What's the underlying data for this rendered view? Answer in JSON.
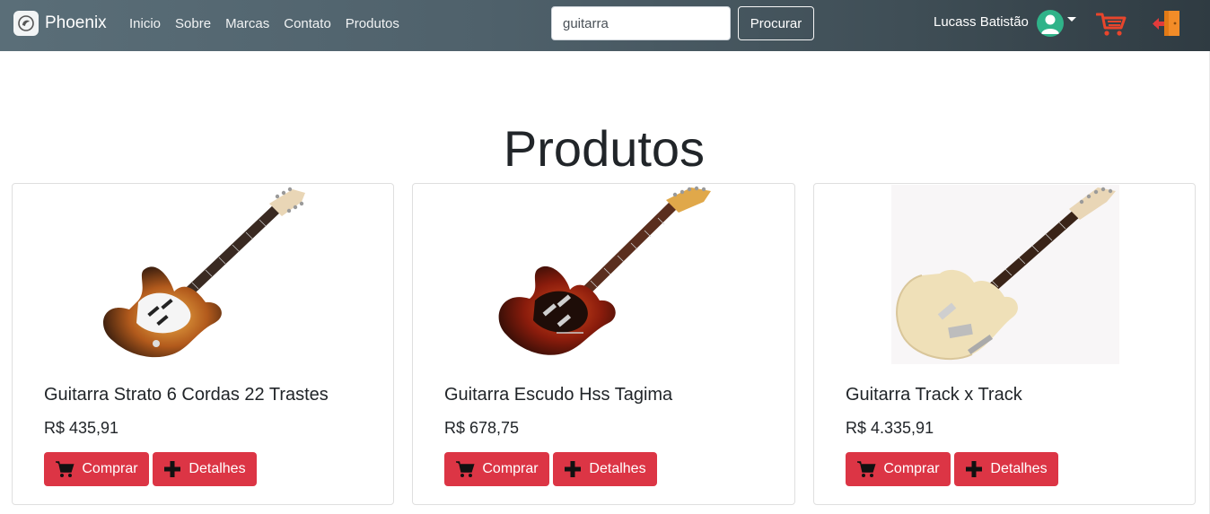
{
  "navbar": {
    "brand": "Phoenix",
    "links": [
      "Inicio",
      "Sobre",
      "Marcas",
      "Contato",
      "Produtos"
    ],
    "search": {
      "value": "guitarra",
      "button_label": "Procurar"
    },
    "user": {
      "name": "Lucass Batistão"
    },
    "icons": [
      "phoenix-logo-icon",
      "user-avatar-icon",
      "caret-down-icon",
      "shopping-cart-icon",
      "logout-door-icon"
    ]
  },
  "main": {
    "title": "Produtos",
    "products": [
      {
        "name": "Guitarra Strato 6 Cordas 22 Trastes",
        "price": "R$ 435,91",
        "buy_label": "Comprar",
        "details_label": "Detalhes"
      },
      {
        "name": "Guitarra Escudo Hss Tagima",
        "price": "R$ 678,75",
        "buy_label": "Comprar",
        "details_label": "Detalhes"
      },
      {
        "name": "Guitarra Track x Track",
        "price": "R$ 4.335,91",
        "buy_label": "Comprar",
        "details_label": "Detalhes"
      }
    ]
  },
  "colors": {
    "navbar_start": "#5a6e78",
    "navbar_end": "#2f3b42",
    "danger": "#dc3545",
    "cart_icon": "#e8452c",
    "avatar": "#2fb389",
    "logout_door": "#f28c28"
  }
}
